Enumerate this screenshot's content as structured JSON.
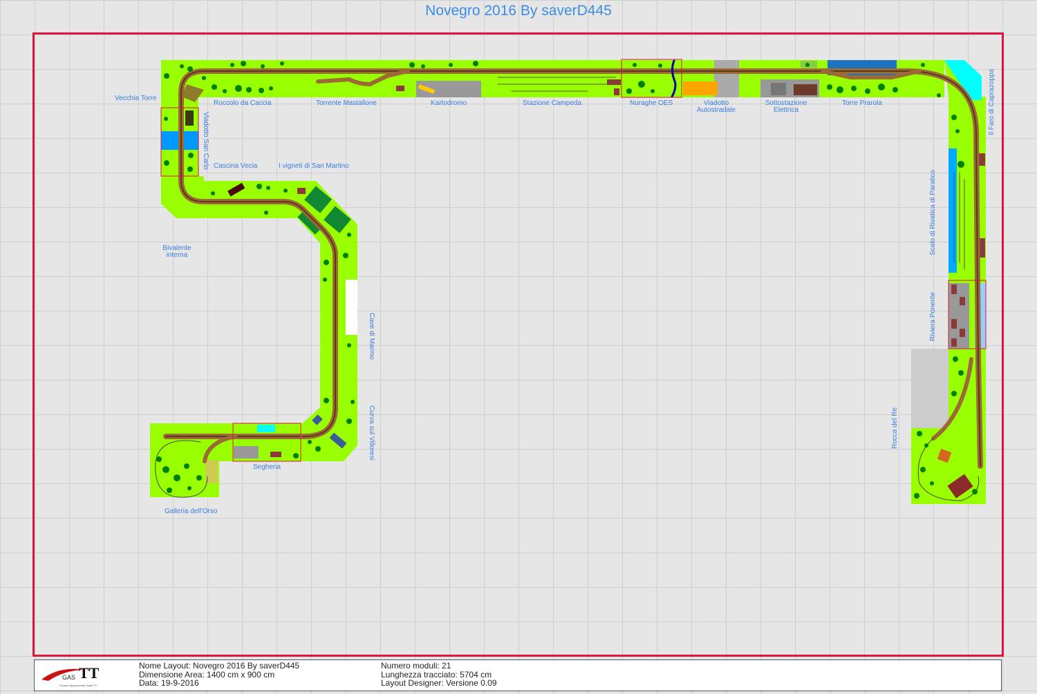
{
  "title": "Novegro 2016 By saverD445",
  "colors": {
    "grass": "#99ff00",
    "track_ballast": "#8b5a2b",
    "border": "#e0143c",
    "label": "#3c7ee0",
    "water": "#0099ff",
    "tree": "#006400"
  },
  "modules": {
    "vecchia_torre": "Vecchia Torre",
    "roccolo": "Roccolo da Caccia",
    "torrente": "Torrente Mastallone",
    "kartodromo": "Kartodromo",
    "stazione": "Stazione Campeda",
    "nuraghe": "Nuraghe OES",
    "viadotto_auto_1": "Viadotto",
    "viadotto_auto_2": "Autostradale",
    "sottostazione_1": "Sottostazione",
    "sottostazione_2": "Elettrica",
    "torre_prarola": "Torre Prarola",
    "faro": "Il Faro di Caprazoppa",
    "viadotto_san_carlo": "Viadotto San Carlo",
    "cascina": "Cascina Vecia",
    "vigneti": "I vigneti di San Martino",
    "bivalente_1": "Bivalente",
    "bivalente_2": "interna",
    "cave": "Cave di Marmo",
    "curva": "Curva sul Villoresi",
    "segheria": "Segheria",
    "galleria": "Galleria dell'Orso",
    "scalo": "Scalo di Rivatica di Paratico",
    "riviera": "Riviera Ponente",
    "rocca": "Rocca del Re"
  },
  "info": {
    "logo_text_big": "TT",
    "logo_text_small": "GAS",
    "logo_caption": "Gruppo Appassionati Scala TT",
    "nome_layout": "Nome Layout: Novegro 2016 By saverD445",
    "dimensione": "Dimensione Area: 1400 cm x 900 cm",
    "data": "Data: 19-9-2016",
    "numero_moduli": "Numero moduli: 21",
    "lunghezza": "Lunghezza tracciato: 5704 cm",
    "designer": "Layout Designer: Versione 0.09"
  }
}
